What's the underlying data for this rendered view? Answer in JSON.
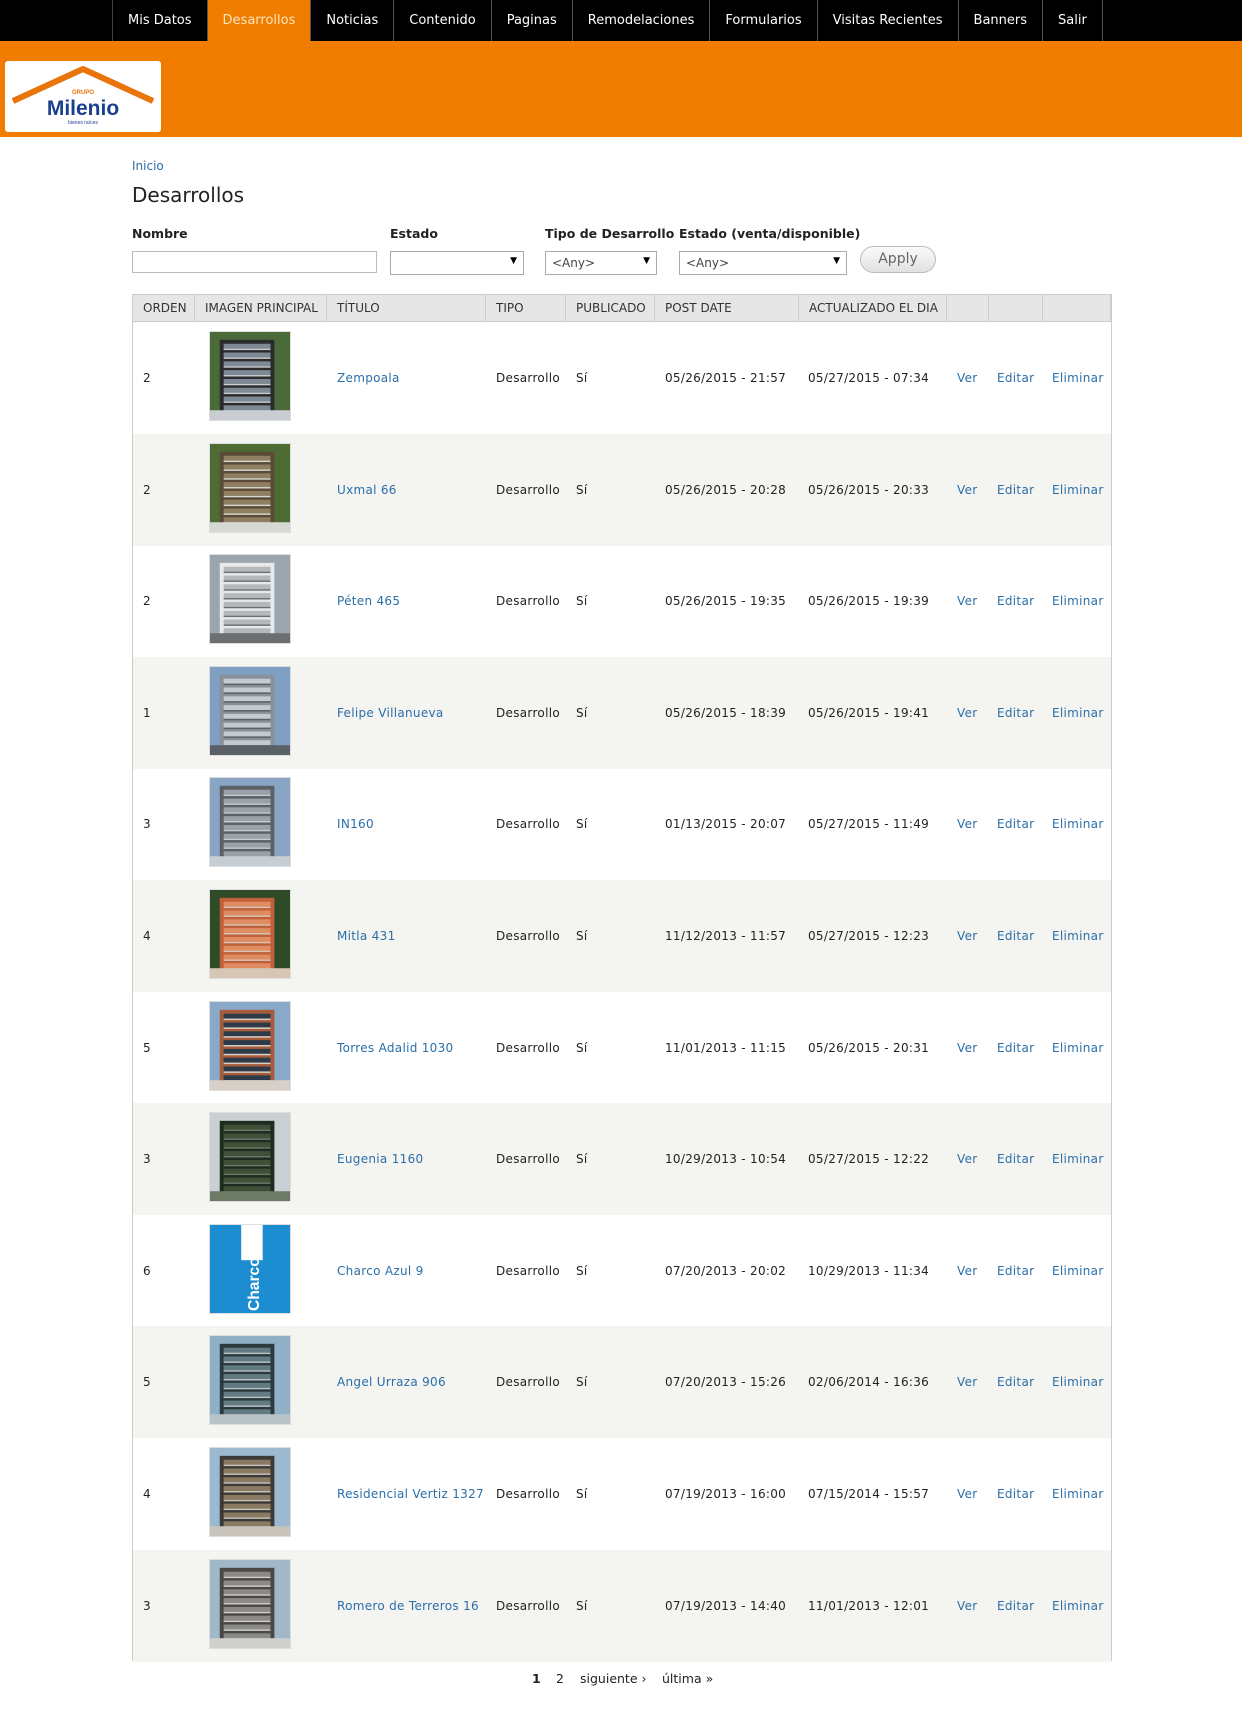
{
  "nav": {
    "items": [
      "Mis Datos",
      "Desarrollos",
      "Noticias",
      "Contenido",
      "Paginas",
      "Remodelaciones",
      "Formularios",
      "Visitas Recientes",
      "Banners",
      "Salir"
    ],
    "active_index": 1
  },
  "logo": {
    "top_text": "GRUPO",
    "name": "Milenio",
    "sub": "bienes raíces"
  },
  "breadcrumb": "Inicio",
  "title": "Desarrollos",
  "filters": {
    "nombre_label": "Nombre",
    "nombre_value": "",
    "estado_label": "Estado",
    "estado_value": "",
    "tipo_label": "Tipo de Desarrollo",
    "tipo_value": "<Any>",
    "estado_vd_label": "Estado (venta/disponible)",
    "estado_vd_value": "<Any>",
    "apply_label": "Apply"
  },
  "table": {
    "headers": [
      "ORDEN",
      "IMAGEN PRINCIPAL",
      "TÍTULO",
      "TIPO",
      "PUBLICADO",
      "POST DATE",
      "ACTUALIZADO EL DIA",
      "",
      "",
      ""
    ],
    "action_labels": {
      "view": "Ver",
      "edit": "Editar",
      "delete": "Eliminar"
    },
    "rows": [
      {
        "orden": "2",
        "titulo": "Zempoala",
        "tipo": "Desarrollo",
        "publicado": "Sí",
        "post_date": "05/26/2015 - 21:57",
        "actualizado": "05/27/2015 - 07:34"
      },
      {
        "orden": "2",
        "titulo": "Uxmal 66",
        "tipo": "Desarrollo",
        "publicado": "Sí",
        "post_date": "05/26/2015 - 20:28",
        "actualizado": "05/26/2015 - 20:33"
      },
      {
        "orden": "2",
        "titulo": "Péten 465",
        "tipo": "Desarrollo",
        "publicado": "Sí",
        "post_date": "05/26/2015 - 19:35",
        "actualizado": "05/26/2015 - 19:39"
      },
      {
        "orden": "1",
        "titulo": "Felipe Villanueva",
        "tipo": "Desarrollo",
        "publicado": "Sí",
        "post_date": "05/26/2015 - 18:39",
        "actualizado": "05/26/2015 - 19:41"
      },
      {
        "orden": "3",
        "titulo": "IN160",
        "tipo": "Desarrollo",
        "publicado": "Sí",
        "post_date": "01/13/2015 - 20:07",
        "actualizado": "05/27/2015 - 11:49"
      },
      {
        "orden": "4",
        "titulo": "Mitla 431",
        "tipo": "Desarrollo",
        "publicado": "Sí",
        "post_date": "11/12/2013 - 11:57",
        "actualizado": "05/27/2015 - 12:23"
      },
      {
        "orden": "5",
        "titulo": "Torres Adalid 1030",
        "tipo": "Desarrollo",
        "publicado": "Sí",
        "post_date": "11/01/2013 - 11:15",
        "actualizado": "05/26/2015 - 20:31"
      },
      {
        "orden": "3",
        "titulo": "Eugenia 1160",
        "tipo": "Desarrollo",
        "publicado": "Sí",
        "post_date": "10/29/2013 - 10:54",
        "actualizado": "05/27/2015 - 12:22"
      },
      {
        "orden": "6",
        "titulo": "Charco Azul 9",
        "tipo": "Desarrollo",
        "publicado": "Sí",
        "post_date": "07/20/2013 - 20:02",
        "actualizado": "10/29/2013 - 11:34",
        "thumb_text": "Charco Azul"
      },
      {
        "orden": "5",
        "titulo": "Angel Urraza 906",
        "tipo": "Desarrollo",
        "publicado": "Sí",
        "post_date": "07/20/2013 - 15:26",
        "actualizado": "02/06/2014 - 16:36"
      },
      {
        "orden": "4",
        "titulo": "Residencial Vertiz 1327",
        "tipo": "Desarrollo",
        "publicado": "Sí",
        "post_date": "07/19/2013 - 16:00",
        "actualizado": "07/15/2014 - 15:57"
      },
      {
        "orden": "3",
        "titulo": "Romero de Terreros 16",
        "tipo": "Desarrollo",
        "publicado": "Sí",
        "post_date": "07/19/2013 - 14:40",
        "actualizado": "11/01/2013 - 12:01"
      }
    ]
  },
  "pager": {
    "page1": "1",
    "page2": "2",
    "next": "siguiente ›",
    "last": "última »"
  }
}
